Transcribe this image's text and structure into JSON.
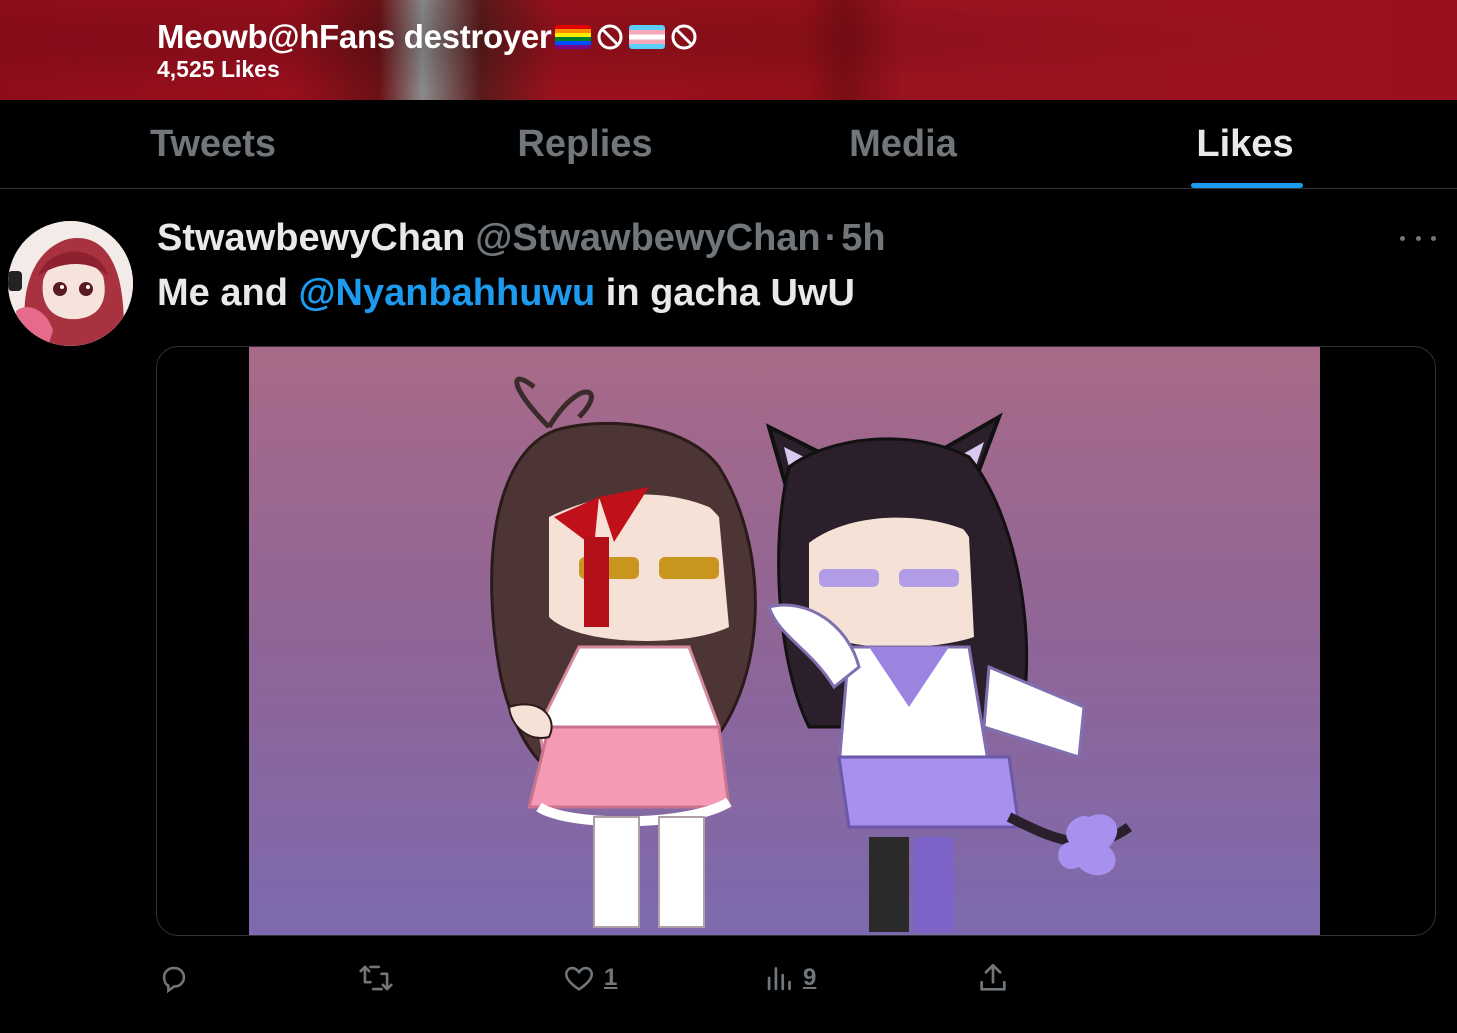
{
  "header": {
    "profile_name": "Meowb@hFans destroyer",
    "likes_count": "4,525 Likes",
    "bg_color": "#9a111e"
  },
  "tabs": [
    {
      "label": "Tweets",
      "active": false
    },
    {
      "label": "Replies",
      "active": false
    },
    {
      "label": "Media",
      "active": false
    },
    {
      "label": "Likes",
      "active": true
    }
  ],
  "tweet": {
    "display_name": "StwawbewyChan",
    "handle": "@StwawbewyChan",
    "separator": "·",
    "time": "5h",
    "text_before": "Me and ",
    "mention": "@Nyanbahhuwu",
    "text_after": " in gacha UwU",
    "actions": {
      "reply": {
        "icon": "reply-icon",
        "count": ""
      },
      "retweet": {
        "icon": "retweet-icon",
        "count": ""
      },
      "like": {
        "icon": "heart-icon",
        "count": "1"
      },
      "views": {
        "icon": "views-icon",
        "count": "9"
      },
      "share": {
        "icon": "share-icon",
        "count": ""
      }
    }
  },
  "colors": {
    "accent": "#1d9bf0",
    "muted": "#71767b",
    "text": "#e7e9ea",
    "background": "#000000"
  }
}
